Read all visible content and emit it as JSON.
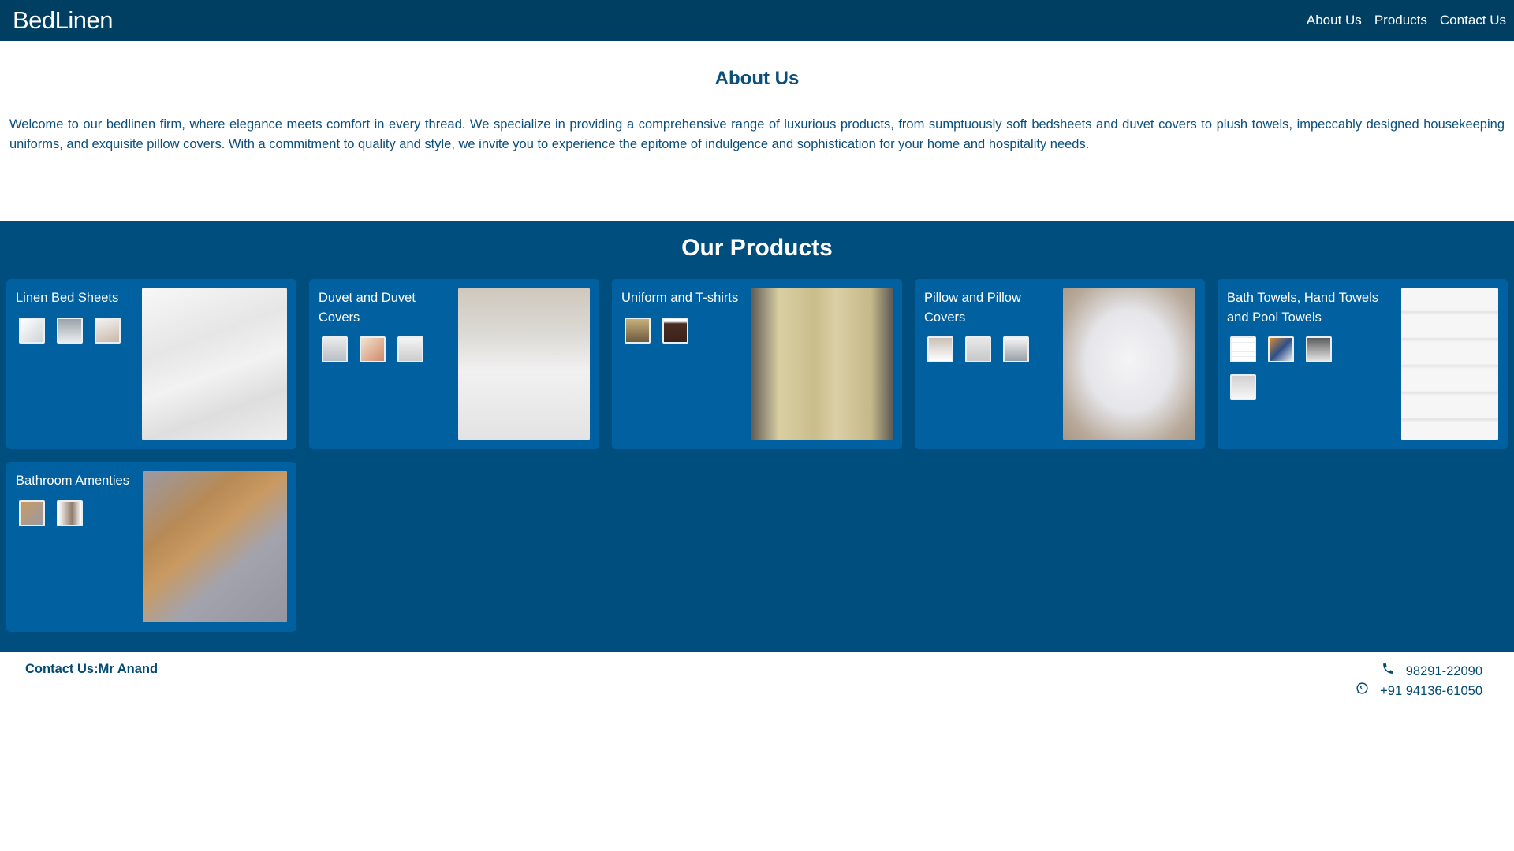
{
  "navbar": {
    "brand": "BedLinen",
    "links": [
      "About Us",
      "Products",
      "Contact Us"
    ]
  },
  "about": {
    "title": "About Us",
    "text": "Welcome to our bedlinen firm, where elegance meets comfort in every thread. We specialize in providing a comprehensive range of luxurious products, from sumptuously soft bedsheets and duvet covers to plush towels, impeccably designed housekeeping uniforms, and exquisite pillow covers. With a commitment to quality and style, we invite you to experience the epitome of indulgence and sophistication for your home and hospitality needs."
  },
  "products": {
    "title": "Our Products",
    "items": [
      {
        "title": "Linen Bed Sheets",
        "thumb_count": 3
      },
      {
        "title": "Duvet and Duvet Covers",
        "thumb_count": 3
      },
      {
        "title": "Uniform and T-shirts",
        "thumb_count": 2
      },
      {
        "title": "Pillow and Pillow Covers",
        "thumb_count": 3
      },
      {
        "title": "Bath Towels, Hand Towels and Pool Towels",
        "thumb_count": 4
      },
      {
        "title": "Bathroom Amenties",
        "thumb_count": 2
      }
    ]
  },
  "footer": {
    "contact": "Contact Us:Mr Anand",
    "phone": "98291-22090",
    "whatsapp": "+91 94136-61050",
    "phone_icon": "phone-icon",
    "whatsapp_icon": "whatsapp-icon"
  },
  "colors": {
    "navbar": "#003e62",
    "products_bg": "#004e7d",
    "card_bg": "#0060a0",
    "text": "#004a73"
  }
}
